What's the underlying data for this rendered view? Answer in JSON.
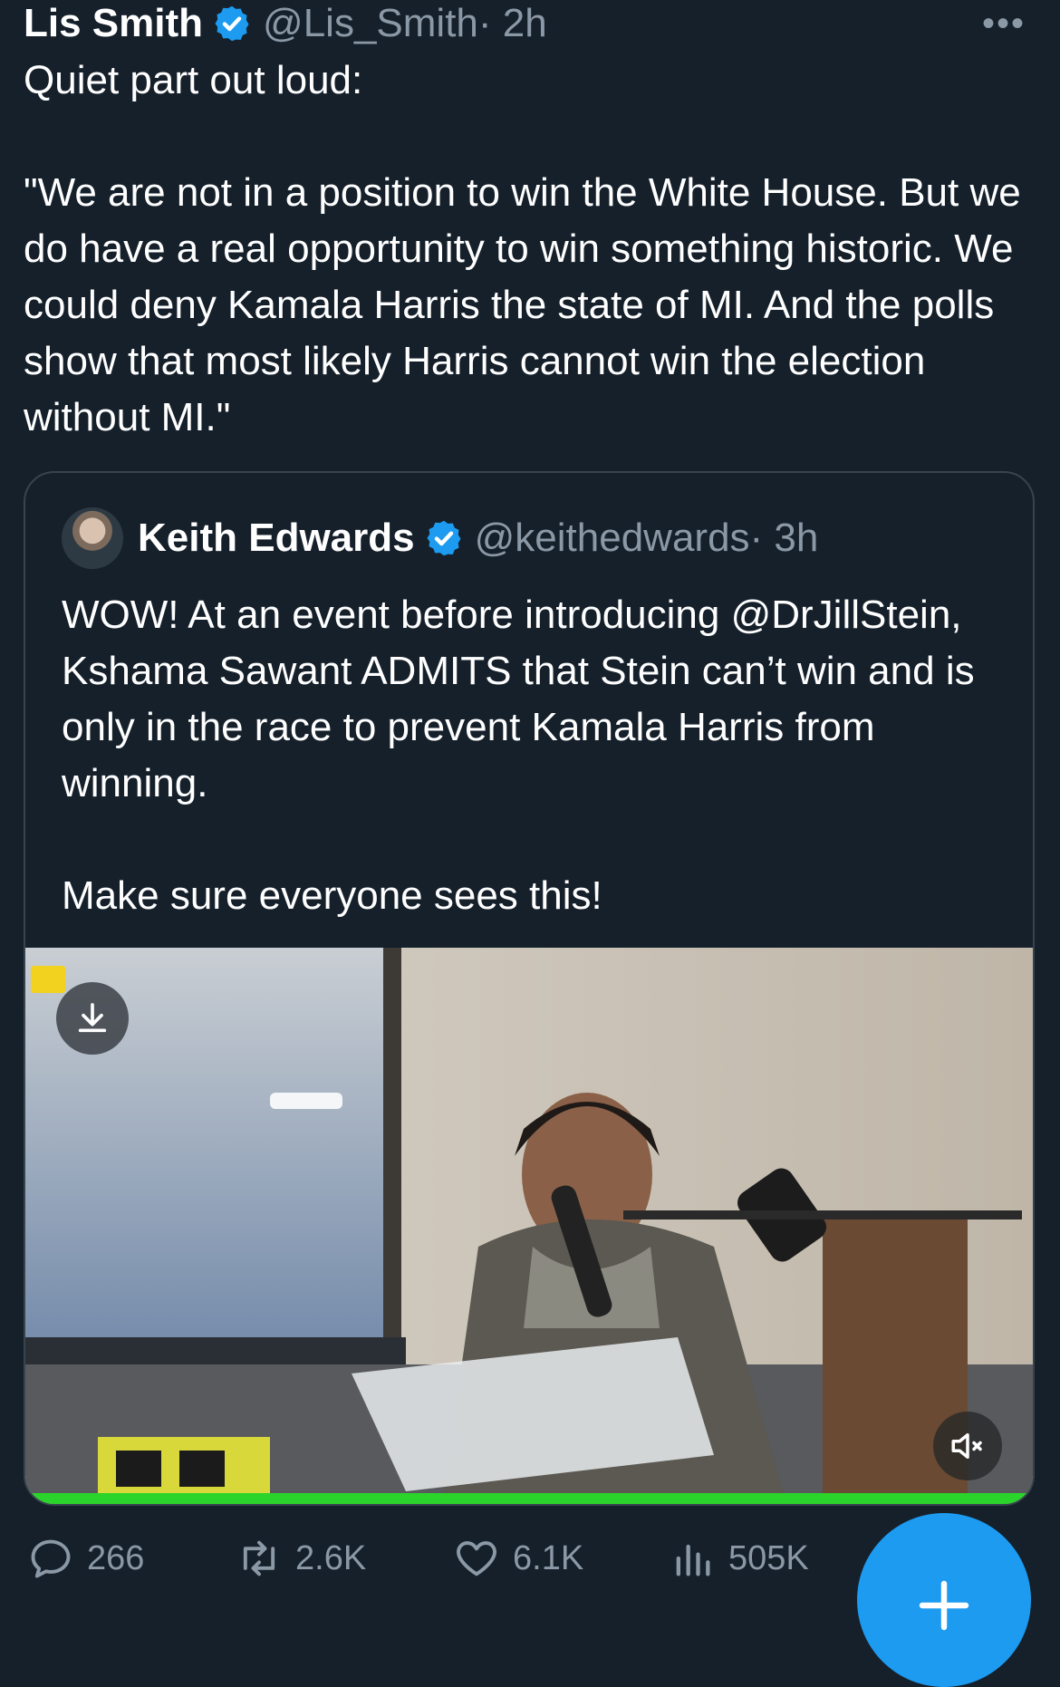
{
  "tweet": {
    "author_name": "Lis Smith",
    "author_handle": "@Lis_Smith",
    "time": "· 2h",
    "more_label": "•••",
    "line1": "Quiet part out loud:",
    "quote_text": "\"We are not in a position to win the White House. But we do have a real opportunity to win something historic. We could deny Kamala Harris the state of MI. And the polls show that most likely Harris cannot win the election without MI.\""
  },
  "quoted": {
    "author_name": "Keith Edwards",
    "author_handle": "@keithedwards",
    "time": "· 3h",
    "text1": "WOW!  At an event before introducing @DrJillStein, Kshama Sawant ADMITS that Stein can’t win and is only in the race to prevent Kamala Harris from winning.",
    "text2": "Make sure everyone sees this!"
  },
  "media": {
    "video_progress_percent": 100,
    "progress_color": "#2bd42b"
  },
  "actions": {
    "replies": "266",
    "reposts": "2.6K",
    "likes": "6.1K",
    "views": "505K"
  },
  "icons": {
    "verified": "verified-badge-icon",
    "more": "more-icon",
    "download": "download-icon",
    "mute": "mute-icon",
    "reply": "reply-icon",
    "repost": "repost-icon",
    "like": "heart-icon",
    "views": "views-icon",
    "compose": "plus-icon"
  },
  "colors": {
    "background": "#15202b",
    "text": "#ffffff",
    "secondary_text": "#8b98a5",
    "accent": "#1d9bf0",
    "border": "#38444d"
  }
}
